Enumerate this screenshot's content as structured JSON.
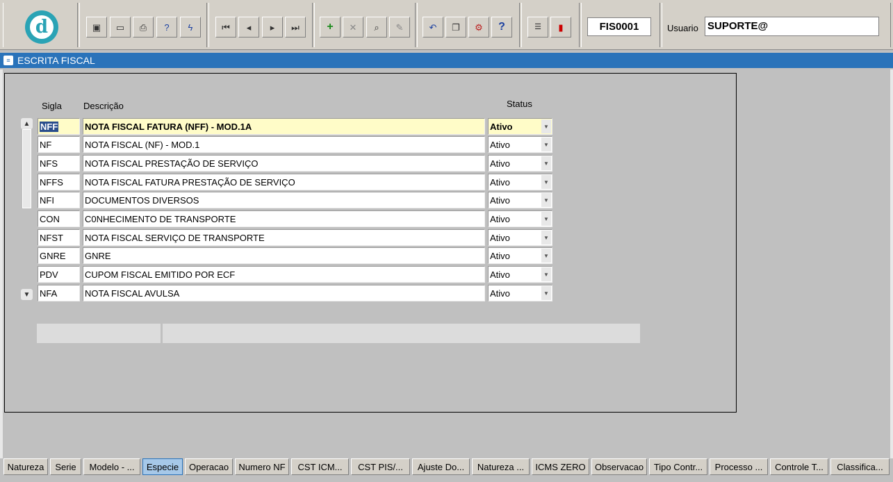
{
  "toolbar": {
    "form_code": "FIS0001",
    "user_label": "Usuario",
    "user_value": "SUPORTE@"
  },
  "window": {
    "title": "ESCRITA FISCAL"
  },
  "grid": {
    "headers": {
      "sigla": "Sigla",
      "descricao": "Descrição",
      "status": "Status"
    },
    "rows": [
      {
        "sigla": "NFF",
        "descricao": "NOTA FISCAL FATURA (NFF) - MOD.1A",
        "status": "Ativo"
      },
      {
        "sigla": "NF",
        "descricao": "NOTA FISCAL (NF) -  MOD.1",
        "status": "Ativo"
      },
      {
        "sigla": "NFS",
        "descricao": "NOTA FISCAL PRESTAÇÃO DE SERVIÇO",
        "status": "Ativo"
      },
      {
        "sigla": "NFFS",
        "descricao": "NOTA FISCAL FATURA PRESTAÇÃO DE SERVIÇO",
        "status": "Ativo"
      },
      {
        "sigla": "NFI",
        "descricao": "DOCUMENTOS DIVERSOS",
        "status": "Ativo"
      },
      {
        "sigla": "CON",
        "descricao": "C0NHECIMENTO DE TRANSPORTE",
        "status": "Ativo"
      },
      {
        "sigla": "NFST",
        "descricao": "NOTA FISCAL SERVIÇO DE TRANSPORTE",
        "status": "Ativo"
      },
      {
        "sigla": "GNRE",
        "descricao": "GNRE",
        "status": "Ativo"
      },
      {
        "sigla": "PDV",
        "descricao": "CUPOM FISCAL EMITIDO POR ECF",
        "status": "Ativo"
      },
      {
        "sigla": "NFA",
        "descricao": "NOTA FISCAL AVULSA",
        "status": "Ativo"
      }
    ]
  },
  "tabs": [
    "Natureza",
    "Serie",
    "Modelo - ...",
    "Especie",
    "Operacao",
    "Numero NF",
    "CST ICM...",
    "CST PIS/...",
    "Ajuste Do...",
    "Natureza ...",
    "ICMS ZERO",
    "Observacao",
    "Tipo Contr...",
    "Processo ...",
    "Controle T...",
    "Classifica..."
  ],
  "active_tab": "Especie"
}
